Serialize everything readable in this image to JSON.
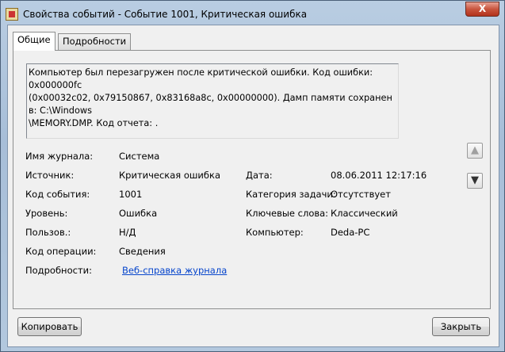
{
  "window": {
    "title": "Свойства событий - Событие 1001, Критическая ошибка",
    "close_label": "X"
  },
  "tabs": [
    {
      "label": "Общие",
      "active": true
    },
    {
      "label": "Подробности",
      "active": false
    }
  ],
  "description_lines": [
    "Компьютер был перезагружен после критической ошибки.  Код ошибки: 0x000000fc",
    "(0x00032c02, 0x79150867, 0x83168a8c, 0x00000000). Дамп памяти сохранен в: C:\\Windows",
    "\\MEMORY.DMP. Код отчета: ."
  ],
  "fields": {
    "log_name": {
      "label": "Имя журнала:",
      "value": "Система"
    },
    "source": {
      "label": "Источник:",
      "value": "Критическая ошибка"
    },
    "event_id": {
      "label": "Код события:",
      "value": "1001"
    },
    "level": {
      "label": "Уровень:",
      "value": "Ошибка"
    },
    "user": {
      "label": "Пользов.:",
      "value": "Н/Д"
    },
    "opcode": {
      "label": "Код операции:",
      "value": "Сведения"
    },
    "details": {
      "label": "Подробности:",
      "value": "Веб-справка журнала"
    },
    "date": {
      "label": "Дата:",
      "value": "08.06.2011 12:17:16"
    },
    "task_category": {
      "label": "Категория задачи:",
      "value": "Отсутствует"
    },
    "keywords": {
      "label": "Ключевые слова:",
      "value": "Классический"
    },
    "computer": {
      "label": "Компьютер:",
      "value": "Deda-PC"
    }
  },
  "nav": {
    "up": "▲",
    "down": "▼"
  },
  "buttons": {
    "copy": "Копировать",
    "close": "Закрыть"
  }
}
